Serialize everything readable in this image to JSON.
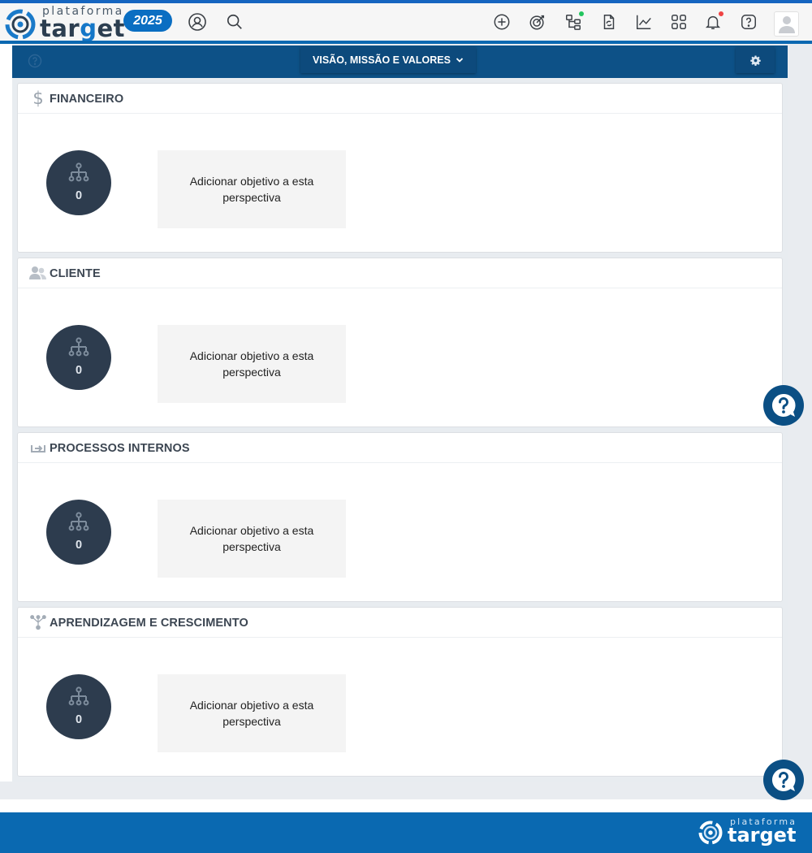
{
  "brand": {
    "small": "plataforma",
    "big_prefix": "tar",
    "big_g": "g",
    "big_suffix": "et",
    "year": "2025"
  },
  "header": {
    "icons": [
      "user-circle-icon",
      "search-icon",
      "add-circle-icon",
      "target-icon",
      "tree-icon",
      "document-refresh-icon",
      "chart-line-icon",
      "apps-grid-icon",
      "bell-icon",
      "help-icon",
      "user-avatar-icon"
    ],
    "status_colors": {
      "online": "#22c55e",
      "alert": "#ef4444"
    }
  },
  "toolbar": {
    "dropdown_label": "VISÃO, MISSÃO E VALORES"
  },
  "perspectives": [
    {
      "title": "FINANCEIRO",
      "icon": "dollar-icon",
      "count": "0",
      "add_label": "Adicionar objetivo a esta perspectiva"
    },
    {
      "title": "CLIENTE",
      "icon": "users-icon",
      "count": "0",
      "add_label": "Adicionar objetivo a esta perspectiva"
    },
    {
      "title": "PROCESSOS INTERNOS",
      "icon": "process-icon",
      "count": "0",
      "add_label": "Adicionar objetivo a esta perspectiva"
    },
    {
      "title": "APRENDIZAGEM E CRESCIMENTO",
      "icon": "branch-icon",
      "count": "0",
      "add_label": "Adicionar objetivo a esta perspectiva"
    }
  ],
  "footer": {
    "small": "plataforma",
    "big": "target"
  },
  "colors": {
    "brand": "#0a69b1",
    "toolbar": "#0d5187",
    "counter": "#2d3c4e"
  }
}
